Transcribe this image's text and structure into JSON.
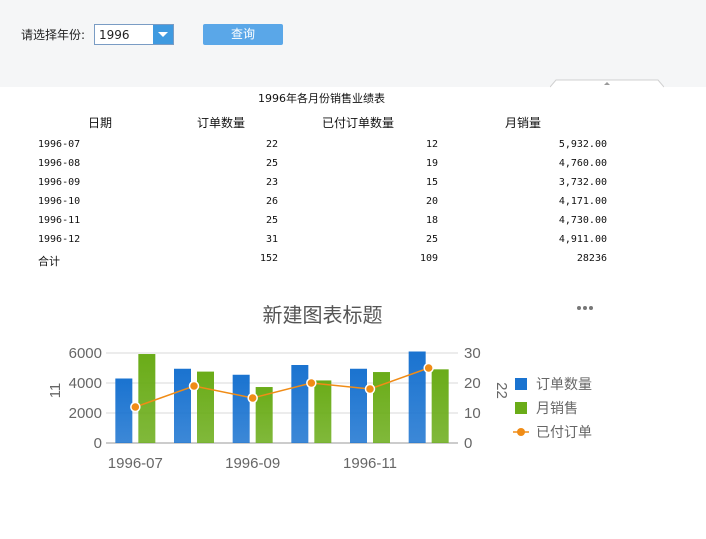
{
  "toolbar": {
    "year_label": "请选择年份:",
    "year_value": "1996",
    "query_label": "查询"
  },
  "report": {
    "title": "1996年各月份销售业绩表",
    "headers": [
      "日期",
      "订单数量",
      "已付订单数量",
      "月销量"
    ],
    "rows": [
      [
        "1996-07",
        "22",
        "12",
        "5,932.00"
      ],
      [
        "1996-08",
        "25",
        "19",
        "4,760.00"
      ],
      [
        "1996-09",
        "23",
        "15",
        "3,732.00"
      ],
      [
        "1996-10",
        "26",
        "20",
        "4,171.00"
      ],
      [
        "1996-11",
        "25",
        "18",
        "4,730.00"
      ],
      [
        "1996-12",
        "31",
        "25",
        "4,911.00"
      ]
    ],
    "total": [
      "合计",
      "152",
      "109",
      "28236"
    ]
  },
  "chart_data": {
    "type": "bar",
    "title": "新建图表标题",
    "categories": [
      "1996-07",
      "1996-08",
      "1996-09",
      "1996-10",
      "1996-11",
      "1996-12"
    ],
    "x_tick_labels": [
      "1996-07",
      "1996-09",
      "1996-11"
    ],
    "y_left_label": "11",
    "y_right_label": "22",
    "y_left_ticks": [
      "0",
      "2000",
      "4000",
      "6000"
    ],
    "y_right_ticks": [
      "0",
      "10",
      "20",
      "30"
    ],
    "ylim_left": [
      0,
      7000
    ],
    "ylim_right": [
      0,
      35
    ],
    "grid": true,
    "legend_position": "right",
    "series": [
      {
        "name": "订单数量",
        "kind": "bar",
        "axis": "left",
        "color": "#1a73d0",
        "values": [
          4300,
          4950,
          4550,
          5200,
          4950,
          6100
        ]
      },
      {
        "name": "月销售",
        "kind": "bar",
        "axis": "left",
        "color": "#6aac18",
        "values": [
          5932,
          4760,
          3732,
          4171,
          4730,
          4911
        ]
      },
      {
        "name": "已付订单",
        "kind": "line",
        "axis": "right",
        "color": "#f08c16",
        "values": [
          12,
          19,
          15,
          20,
          18,
          25
        ]
      }
    ]
  }
}
